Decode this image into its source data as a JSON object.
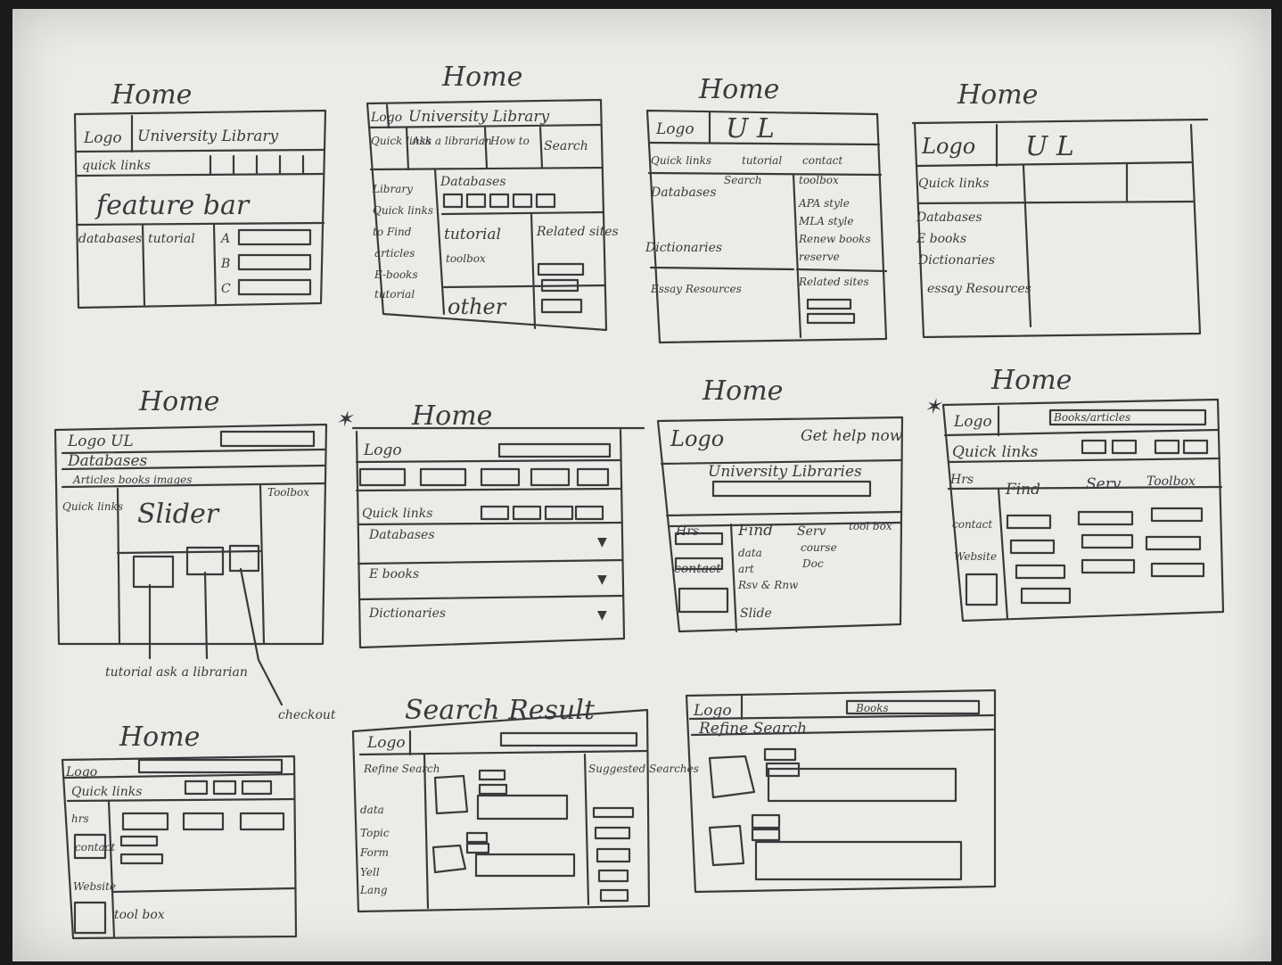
{
  "sketches": {
    "s1": {
      "title": "Home",
      "logo": "Logo",
      "site": "University Library",
      "quick": "quick links",
      "feature": "feature bar",
      "db": "databases",
      "tut": "tutorial",
      "a": "A",
      "b": "B",
      "c": "C"
    },
    "s2": {
      "title": "Home",
      "logo": "Logo",
      "site": "University Library",
      "quick": "Quick links",
      "ask": "Ask a librarian",
      "howto": "How to",
      "search": "Search",
      "db": "Databases",
      "left": [
        "Library",
        "Quick links",
        "to Find",
        "articles",
        "E-books",
        "tutorial"
      ],
      "tutorial": "tutorial",
      "toolbox": "toolbox",
      "related": "Related sites",
      "other": "other"
    },
    "s3": {
      "title": "Home",
      "logo": "Logo",
      "ul": "U L",
      "quick": "Quick links",
      "tutorial": "tutorial",
      "contact": "contact",
      "search": "Search",
      "toolbox": "toolbox",
      "db": "Databases",
      "right": [
        "APA style",
        "MLA style",
        "Renew books",
        "reserve"
      ],
      "dict": "Dictionaries",
      "essay": "Essay Resources",
      "related": "Related sites"
    },
    "s4": {
      "title": "Home",
      "logo": "Logo",
      "ul": "U L",
      "quick": "Quick links",
      "list": [
        "Databases",
        "E books",
        "Dictionaries",
        "essay Resources"
      ]
    },
    "s5": {
      "title": "Home",
      "logo": "Logo UL",
      "db": "Databases",
      "tabs": "Articles  books  images",
      "toolbox": "Toolbox",
      "quick": "Quick links",
      "slider": "Slider",
      "note1": "tutorial  ask a librarian",
      "note2": "checkout"
    },
    "s6": {
      "title": "Home",
      "logo": "Logo",
      "quick": "Quick links",
      "rows": [
        "Databases",
        "E books",
        "Dictionaries"
      ]
    },
    "s7": {
      "title": "Home",
      "logo": "Logo",
      "gethelp": "Get help now",
      "ul": "University Libraries",
      "hrs": "Hrs",
      "contact": "contact",
      "find": "Find",
      "serv": "Serv",
      "toolbox": "tool box",
      "cols": [
        "data",
        "art",
        "Rsv & Rnw"
      ],
      "more": [
        "course",
        "Doc"
      ],
      "slide": "Slide"
    },
    "s8": {
      "title": "Home",
      "logo": "Logo",
      "search": "Books/articles",
      "quick": "Quick links",
      "hrs": "Hrs",
      "find": "Find",
      "serv": "Serv",
      "toolbox": "Toolbox",
      "left": [
        "contact",
        "Website"
      ]
    },
    "s9": {
      "title": "Home",
      "logo": "Logo",
      "quick": "Quick links",
      "left": [
        "hrs",
        "contact",
        "Website"
      ],
      "toolbox": "tool box"
    },
    "s10": {
      "title": "Search Result",
      "logo": "Logo",
      "refine": "Refine Search",
      "facets": [
        "data",
        "Topic",
        "Form",
        "Yell",
        "Lang"
      ],
      "suggest": "Suggested Searches"
    },
    "s11": {
      "logo": "Logo",
      "box": "Books",
      "refine": "Refine Search"
    }
  }
}
